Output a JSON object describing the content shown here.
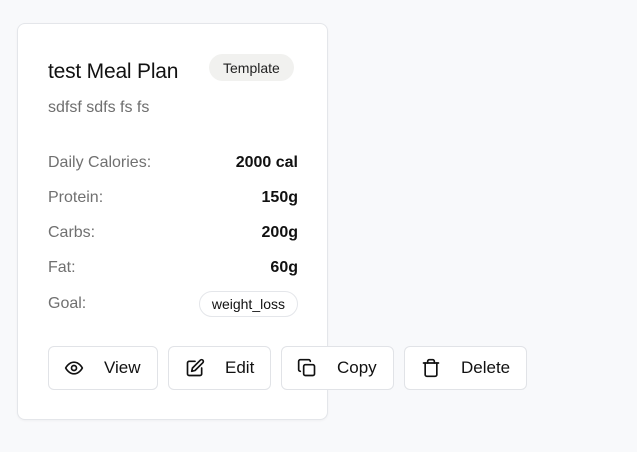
{
  "card": {
    "title": "test Meal Plan",
    "badge": "Template",
    "description": "sdfsf sdfs fs fs",
    "stats": [
      {
        "label": "Daily Calories:",
        "value": "2000 cal"
      },
      {
        "label": "Protein:",
        "value": "150g"
      },
      {
        "label": "Carbs:",
        "value": "200g"
      },
      {
        "label": "Fat:",
        "value": "60g"
      }
    ],
    "goal": {
      "label": "Goal:",
      "value": "weight_loss"
    }
  },
  "actions": {
    "view": {
      "label": "View",
      "icon": "eye-icon"
    },
    "edit": {
      "label": "Edit",
      "icon": "edit-icon"
    },
    "copy": {
      "label": "Copy",
      "icon": "copy-icon"
    },
    "delete": {
      "label": "Delete",
      "icon": "trash-icon"
    }
  },
  "colors": {
    "background": "#f8f9fb",
    "card": "#ffffff",
    "border": "#e4e6ea",
    "badge_bg": "#f1f1ef",
    "muted_text": "#707070"
  }
}
